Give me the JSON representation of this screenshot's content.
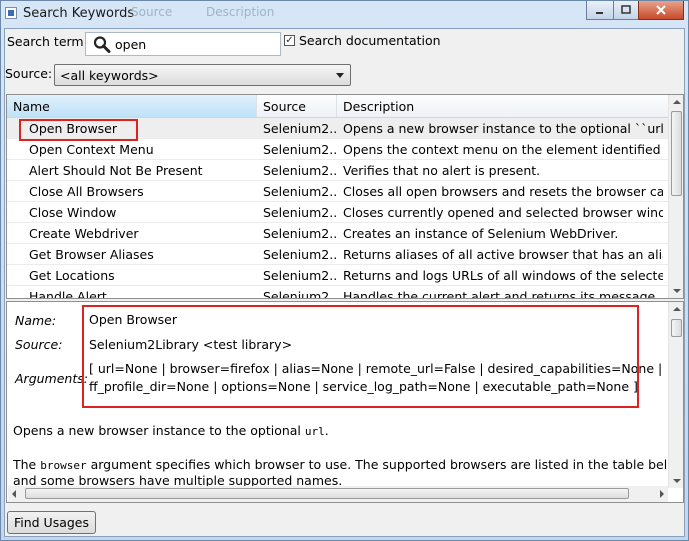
{
  "window": {
    "title": "Search Keywords",
    "ghost_tabs": [
      "Source",
      "Description"
    ],
    "controls": [
      "minimize",
      "maximize",
      "close"
    ]
  },
  "search": {
    "term_label": "Search term:",
    "term_value": "open",
    "search_doc_label": "Search documentation",
    "search_doc_checked": true,
    "source_label": "Source:",
    "source_value": "<all keywords>"
  },
  "table": {
    "columns": [
      "Name",
      "Source",
      "Description"
    ],
    "rows": [
      {
        "name": "Open Browser",
        "source": "Selenium2...",
        "description": "Opens a new browser instance to the optional ``url``."
      },
      {
        "name": "Open Context Menu",
        "source": "Selenium2...",
        "description": "Opens the context menu on the element identified by..."
      },
      {
        "name": "Alert Should Not Be Present",
        "source": "Selenium2...",
        "description": "Verifies that no alert is present."
      },
      {
        "name": "Close All Browsers",
        "source": "Selenium2...",
        "description": "Closes all open browsers and resets the browser cac..."
      },
      {
        "name": "Close Window",
        "source": "Selenium2...",
        "description": "Closes currently opened and selected browser windo..."
      },
      {
        "name": "Create Webdriver",
        "source": "Selenium2...",
        "description": "Creates an instance of Selenium WebDriver."
      },
      {
        "name": "Get Browser Aliases",
        "source": "Selenium2...",
        "description": "Returns aliases of all active browser that has an alias..."
      },
      {
        "name": "Get Locations",
        "source": "Selenium2...",
        "description": "Returns and logs URLs of all windows of the selected..."
      },
      {
        "name": "Handle Alert",
        "source": "Selenium2...",
        "description": "Handles the current alert and returns its message."
      }
    ],
    "selected_index": 0
  },
  "details": {
    "name_label": "Name:",
    "name_value": "Open Browser",
    "source_label": "Source:",
    "source_value": "Selenium2Library <test library>",
    "arguments_label": "Arguments:",
    "arguments_line1": "[ url=None | browser=firefox | alias=None | remote_url=False | desired_capabilities=None |",
    "arguments_line2": "ff_profile_dir=None | options=None | service_log_path=None | executable_path=None ]",
    "para1_prefix": "Opens a new browser instance to the optional ",
    "para1_code": "url",
    "para1_suffix": ".",
    "para2_prefix": "The ",
    "para2_code": "browser",
    "para2_suffix": " argument specifies which browser to use. The supported browsers are listed in the table below. The",
    "para3": "and some browsers have multiple supported names."
  },
  "buttons": {
    "find_usages": "Find Usages"
  },
  "colors": {
    "highlight_red": "#dd2222",
    "header_selected": "#bfe2f8"
  }
}
